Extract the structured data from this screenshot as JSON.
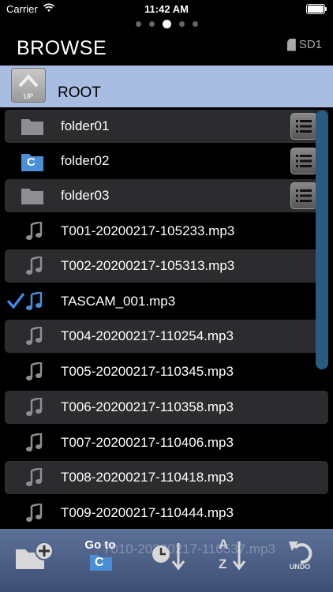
{
  "status": {
    "carrier": "Carrier",
    "time": "11:42 AM"
  },
  "header": {
    "title": "BROWSE",
    "storage": "SD1"
  },
  "root_bar": {
    "up_label": "UP",
    "current_folder": "ROOT"
  },
  "items": [
    {
      "name": "folder01",
      "type": "folder"
    },
    {
      "name": "folder02",
      "type": "folder-current",
      "badge": "C"
    },
    {
      "name": "folder03",
      "type": "folder"
    },
    {
      "name": "T001-20200217-105233.mp3",
      "type": "file"
    },
    {
      "name": "T002-20200217-105313.mp3",
      "type": "file"
    },
    {
      "name": "TASCAM_001.mp3",
      "type": "file",
      "checked": true
    },
    {
      "name": "T004-20200217-110254.mp3",
      "type": "file"
    },
    {
      "name": "T005-20200217-110345.mp3",
      "type": "file"
    },
    {
      "name": "T006-20200217-110358.mp3",
      "type": "file"
    },
    {
      "name": "T007-20200217-110406.mp3",
      "type": "file"
    },
    {
      "name": "T008-20200217-110418.mp3",
      "type": "file"
    },
    {
      "name": "T009-20200217-110444.mp3",
      "type": "file"
    }
  ],
  "partial_item": "T010-20200217-110537.mp3",
  "toolbar": {
    "goto_label": "Go to",
    "goto_badge": "C",
    "sort_az_top": "A",
    "sort_az_bottom": "Z",
    "undo_label": "UNDO"
  },
  "colors": {
    "root_bar": "#a9bde2",
    "toolbar": "#4f6287",
    "scrollbar": "#2a5a7e",
    "check": "#3b8ff0",
    "folder_current": "#4a8fd6"
  }
}
